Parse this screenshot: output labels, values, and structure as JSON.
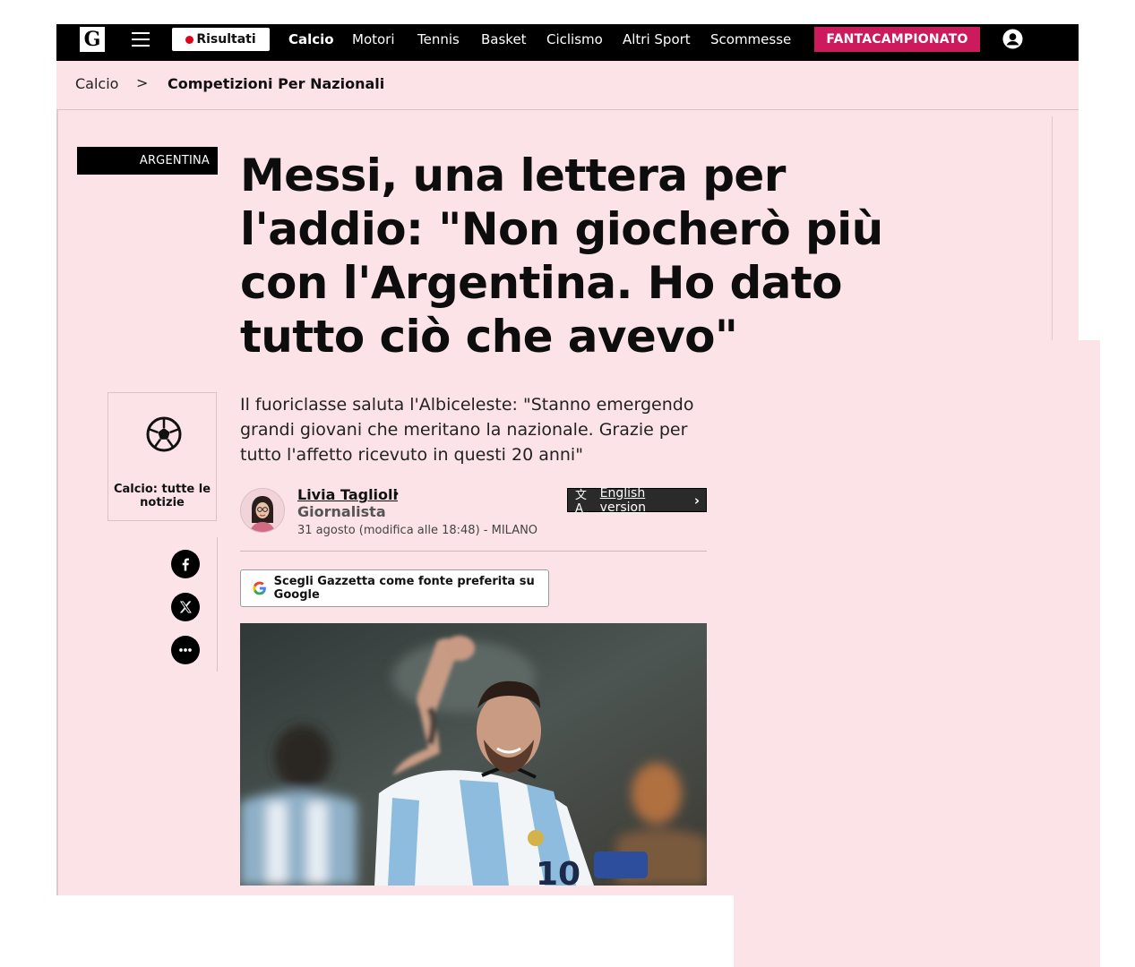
{
  "header": {
    "logo_letter": "G",
    "results_label": "Risultati",
    "nav": [
      {
        "label": "Calcio",
        "active": true
      },
      {
        "label": "Motori"
      },
      {
        "label": "Tennis"
      },
      {
        "label": "Basket"
      },
      {
        "label": "Ciclismo"
      },
      {
        "label": "Altri Sport"
      },
      {
        "label": "Scommesse"
      }
    ],
    "cta_label": "FANTACAMPIONATO"
  },
  "breadcrumb": {
    "items": [
      "Calcio",
      "Competizioni Per Nazionali"
    ],
    "separator": ">"
  },
  "article": {
    "tag": "ARGENTINA",
    "title": "Messi, una lettera per l'addio: \"Non giocherò più con l'Argentina. Ho dato tutto ciò che avevo\"",
    "subtitle": "Il fuoriclasse saluta l'Albiceleste: \"Stanno emergendo grandi giovani che meritano la nazionale. Grazie per tutto l'affetto ricevuto in questi 20 anni\"",
    "author": {
      "name": "Livia Taglioli",
      "role": "Giornalista",
      "date": "31 agosto (modifica alle 18:48) - MILANO"
    },
    "english_version_label": "English version",
    "google_button_label": "Scegli Gazzetta come fonte preferita su Google"
  },
  "category_box": {
    "label": "Calcio: tutte le notizie"
  },
  "share": [
    "facebook-icon",
    "x-icon",
    "more-icon"
  ],
  "colors": {
    "page_bg": "#fbe3e7",
    "nav_bg": "#000000",
    "cta_bg": "#cc1a5c",
    "live_dot": "#e3001b"
  }
}
